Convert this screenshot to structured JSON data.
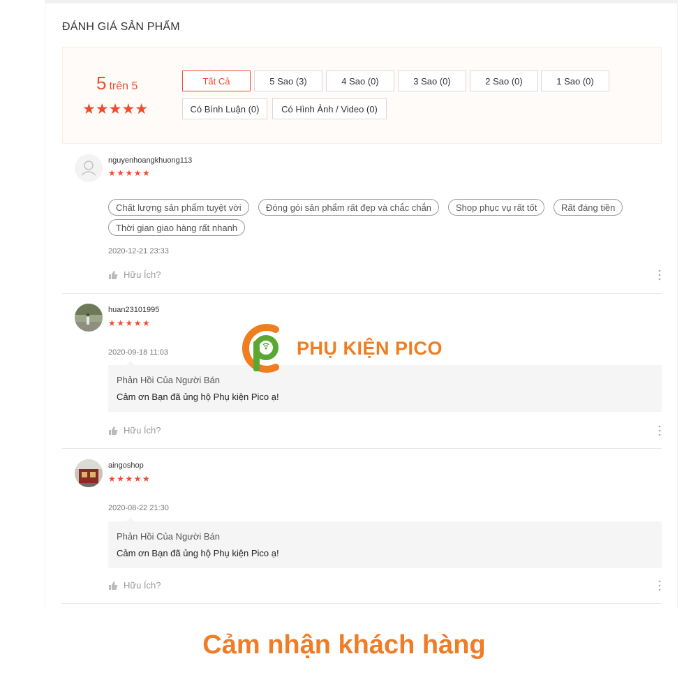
{
  "section": {
    "title": "ĐÁNH GIÁ SẢN PHẨM"
  },
  "summary": {
    "score": "5",
    "score_suffix": "trên 5",
    "stars": "★★★★★",
    "rating": 5
  },
  "filters": [
    {
      "label": "Tất Cả",
      "active": true
    },
    {
      "label": "5 Sao (3)",
      "active": false
    },
    {
      "label": "4 Sao (0)",
      "active": false
    },
    {
      "label": "3 Sao (0)",
      "active": false
    },
    {
      "label": "2 Sao (0)",
      "active": false
    },
    {
      "label": "1 Sao (0)",
      "active": false
    },
    {
      "label": "Có Bình Luận (0)",
      "active": false
    },
    {
      "label": "Có Hình Ảnh / Video (0)",
      "active": false
    }
  ],
  "reviews": [
    {
      "username": "nguyenhoangkhuong113",
      "stars": "★★★★★",
      "rating": 5,
      "tags": [
        "Chất lượng sản phẩm tuyệt vời",
        "Đóng gói sản phẩm rất đẹp và chắc chắn",
        "Shop phục vụ rất tốt",
        "Rất đáng tiền",
        "Thời gian giao hàng rất nhanh"
      ],
      "date": "2020-12-21 23:33",
      "helpful": "Hữu Ích?"
    },
    {
      "username": "huan23101995",
      "stars": "★★★★★",
      "rating": 5,
      "date": "2020-09-18 11:03",
      "reply_title": "Phản Hồi Của Người Bán",
      "reply_text": "Cảm ơn Bạn đã ủng hộ Phụ kiện Pico ạ!",
      "helpful": "Hữu Ích?"
    },
    {
      "username": "aingoshop",
      "stars": "★★★★★",
      "rating": 5,
      "date": "2020-08-22 21:30",
      "reply_title": "Phản Hồi Của Người Bán",
      "reply_text": "Cảm ơn Bạn đã ủng hộ Phụ kiện Pico ạ!",
      "helpful": "Hữu Ích?"
    }
  ],
  "watermark": {
    "brand": "PHỤ KIỆN PICO"
  },
  "caption": "Cảm nhận khách hàng",
  "colors": {
    "accent": "#ee4d2d",
    "brand_orange": "#f07d1f",
    "brand_green": "#5aa832"
  }
}
